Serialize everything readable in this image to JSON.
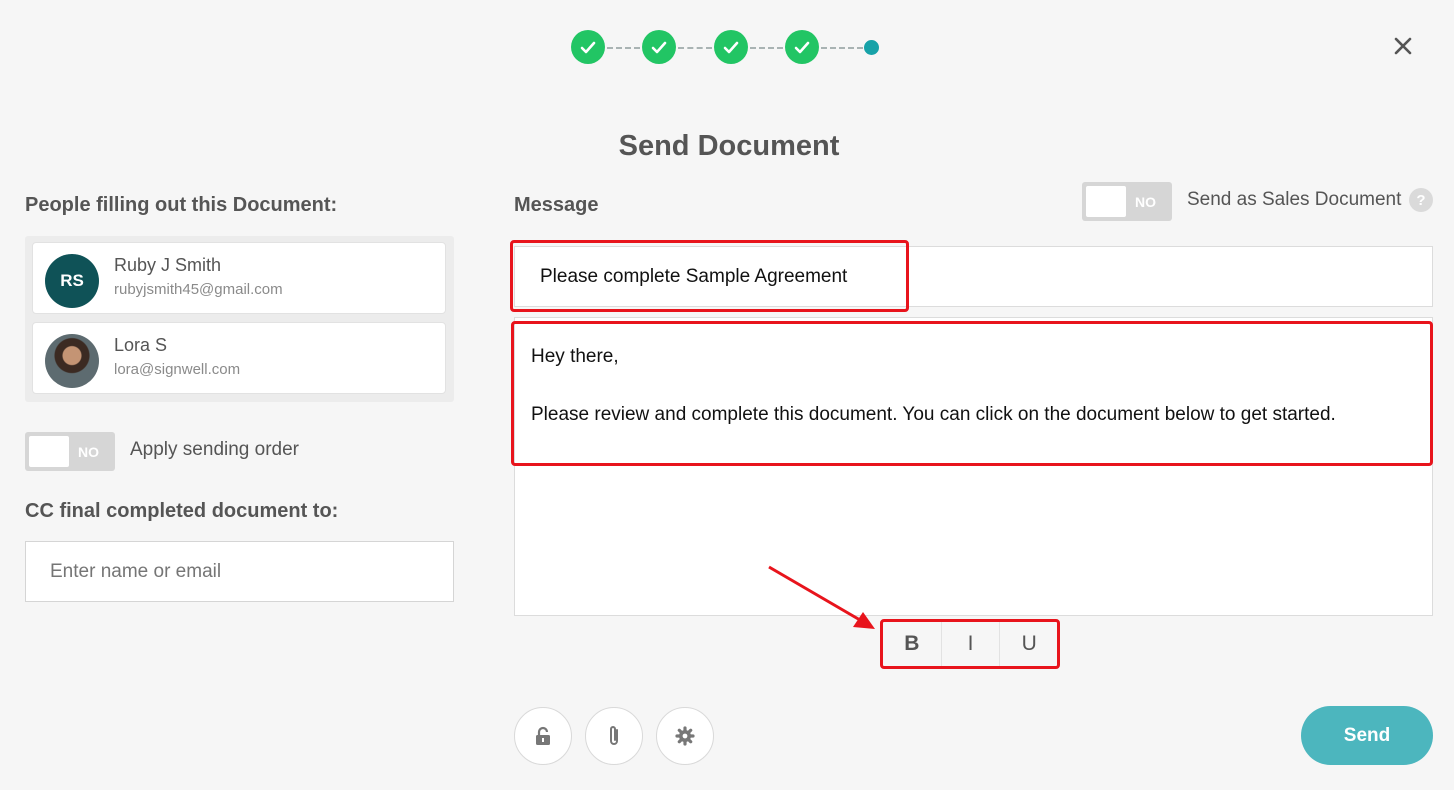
{
  "stepper": {
    "completed_steps": 4,
    "current_step": 5,
    "total_steps": 5
  },
  "dialog": {
    "title": "Send Document"
  },
  "people": {
    "heading": "People filling out this Document:",
    "list": [
      {
        "initials": "RS",
        "name": "Ruby J Smith",
        "email": "rubyjsmith45@gmail.com"
      },
      {
        "name": "Lora S",
        "email": "lora@signwell.com"
      }
    ]
  },
  "sending_order": {
    "toggle": "NO",
    "label": "Apply sending order"
  },
  "cc": {
    "heading": "CC final completed document to:",
    "placeholder": "Enter name or email"
  },
  "message": {
    "heading": "Message",
    "subject": "Please complete Sample Agreement",
    "body_line1": "Hey there,",
    "body_line2": "Please review and complete this document. You can click on the document below to get started."
  },
  "sales": {
    "toggle": "NO",
    "label": "Send as Sales Document",
    "help": "?"
  },
  "format": {
    "bold": "B",
    "italic": "I",
    "underline": "U"
  },
  "actions": {
    "send": "Send"
  },
  "colors": {
    "accent": "#4cb6be",
    "success": "#22c564",
    "highlight": "#e8141c"
  }
}
